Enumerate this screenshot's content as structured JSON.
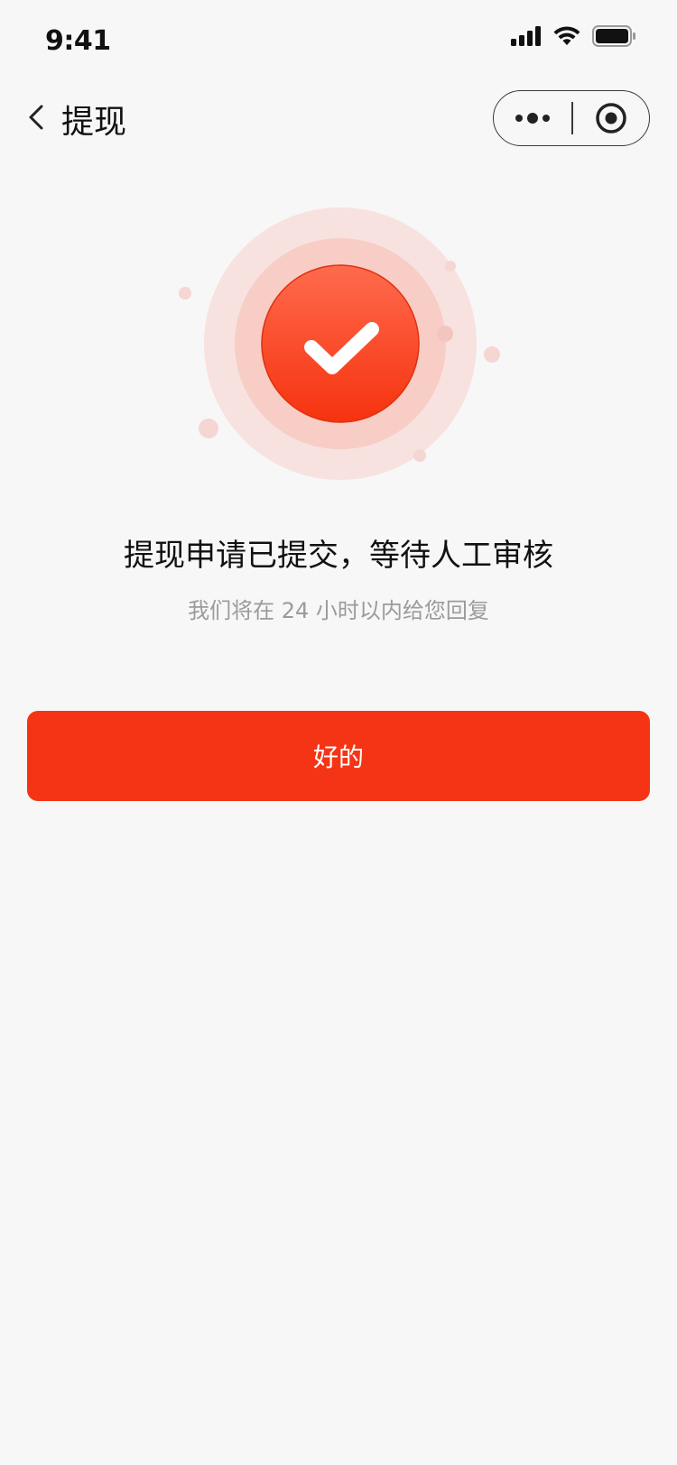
{
  "status_bar": {
    "time": "9:41",
    "icons": [
      "signal-icon",
      "wifi-icon",
      "battery-icon"
    ]
  },
  "nav": {
    "title": "提现",
    "back_icon": "chevron-left-icon",
    "capsule": {
      "more_icon": "more-dots-icon",
      "close_icon": "target-circle-icon"
    }
  },
  "result": {
    "icon": "check-circle-icon",
    "title": "提现申请已提交，等待人工审核",
    "subtitle": "我们将在 24 小时以内给您回复"
  },
  "actions": {
    "ok_label": "好的"
  },
  "colors": {
    "background": "#f7f7f7",
    "accent": "#f53415",
    "subtitle_text": "#9b9b9b"
  }
}
